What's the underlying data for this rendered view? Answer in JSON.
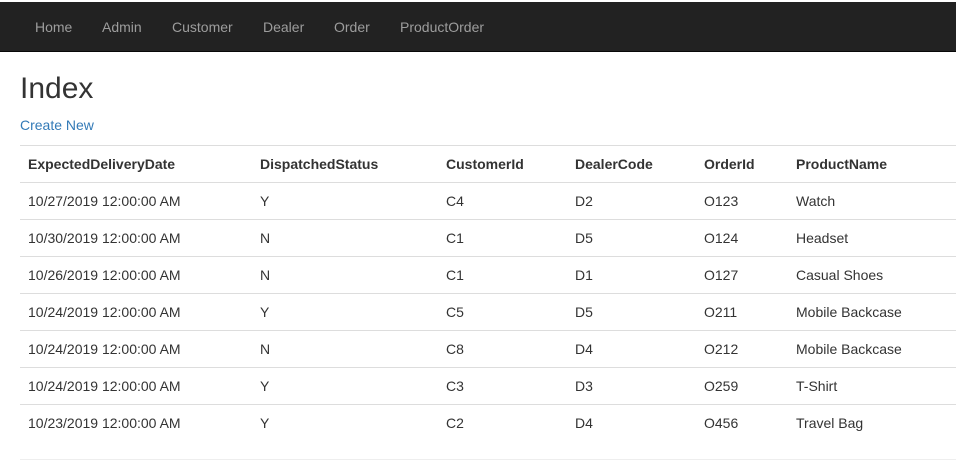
{
  "nav": {
    "items": [
      {
        "label": "Home"
      },
      {
        "label": "Admin"
      },
      {
        "label": "Customer"
      },
      {
        "label": "Dealer"
      },
      {
        "label": "Order"
      },
      {
        "label": "ProductOrder"
      }
    ]
  },
  "main": {
    "title": "Index",
    "create_link": "Create New"
  },
  "table": {
    "headers": [
      "ExpectedDeliveryDate",
      "DispatchedStatus",
      "CustomerId",
      "DealerCode",
      "OrderId",
      "ProductName"
    ],
    "rows": [
      [
        "10/27/2019 12:00:00 AM",
        "Y",
        "C4",
        "D2",
        "O123",
        "Watch"
      ],
      [
        "10/30/2019 12:00:00 AM",
        "N",
        "C1",
        "D5",
        "O124",
        "Headset"
      ],
      [
        "10/26/2019 12:00:00 AM",
        "N",
        "C1",
        "D1",
        "O127",
        "Casual Shoes"
      ],
      [
        "10/24/2019 12:00:00 AM",
        "Y",
        "C5",
        "D5",
        "O211",
        "Mobile Backcase"
      ],
      [
        "10/24/2019 12:00:00 AM",
        "N",
        "C8",
        "D4",
        "O212",
        "Mobile Backcase"
      ],
      [
        "10/24/2019 12:00:00 AM",
        "Y",
        "C3",
        "D3",
        "O259",
        "T-Shirt"
      ],
      [
        "10/23/2019 12:00:00 AM",
        "Y",
        "C2",
        "D4",
        "O456",
        "Travel Bag"
      ]
    ]
  },
  "colors": {
    "navbar_bg": "#222222",
    "nav_text": "#9d9d9d",
    "link": "#337ab7",
    "border": "#dddddd"
  }
}
